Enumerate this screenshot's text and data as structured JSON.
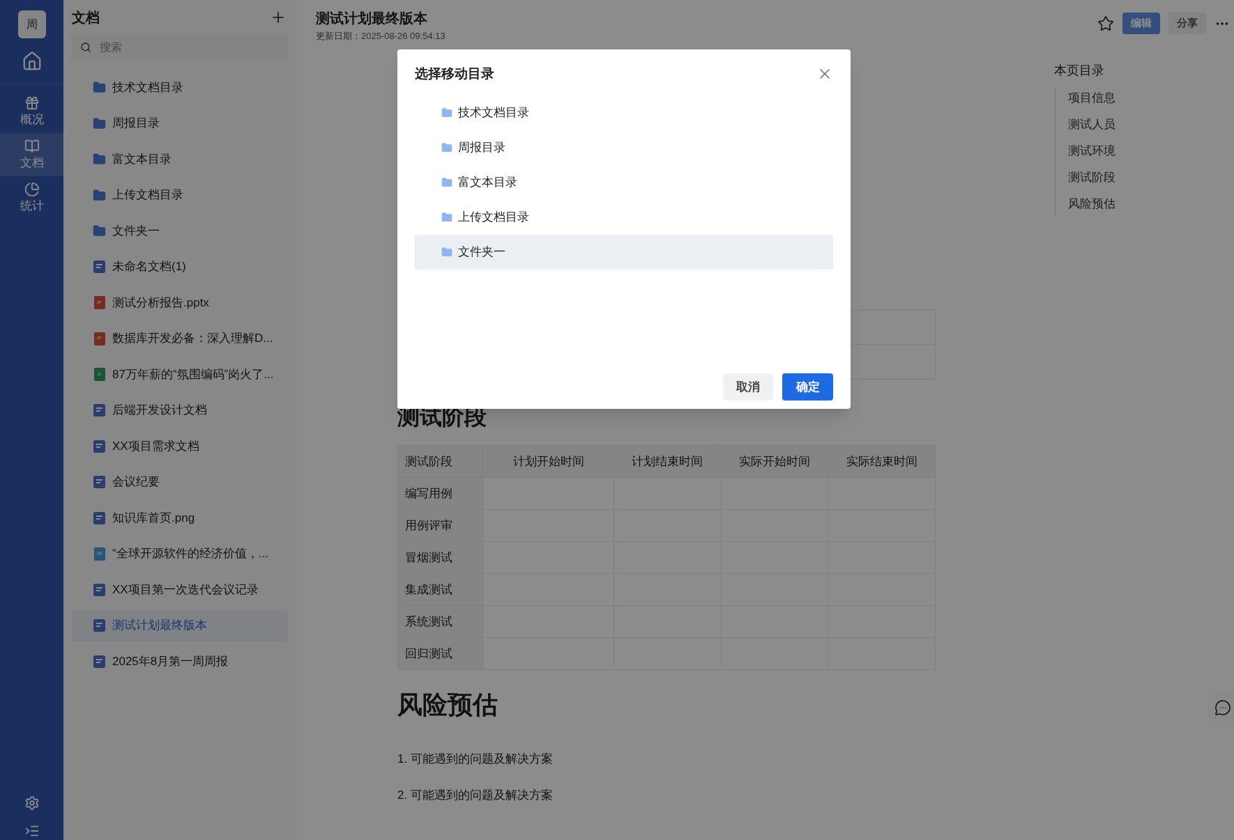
{
  "nav": {
    "avatar": "周",
    "items": [
      {
        "kind": "home",
        "selected": false
      },
      {
        "kind": "overview",
        "label": "概况",
        "selected": false
      },
      {
        "kind": "docs",
        "label": "文档",
        "selected": true
      },
      {
        "kind": "stats",
        "label": "统计",
        "selected": false
      }
    ]
  },
  "sidebar": {
    "title": "文档",
    "search": {
      "placeholder": "搜索"
    },
    "items": [
      {
        "kind": "folder",
        "label": "技术文档目录",
        "selected": false
      },
      {
        "kind": "folder",
        "label": "周报目录",
        "selected": false
      },
      {
        "kind": "folder",
        "label": "富文本目录",
        "selected": false
      },
      {
        "kind": "folder",
        "label": "上传文档目录",
        "selected": false
      },
      {
        "kind": "folder",
        "label": "文件夹一",
        "selected": false
      },
      {
        "kind": "doc",
        "label": "未命名文档(1)",
        "selected": false
      },
      {
        "kind": "ppt",
        "badge": "P",
        "label": "测试分析报告.pptx",
        "selected": false
      },
      {
        "kind": "ppt",
        "badge": "P",
        "label": "数据库开发必备：深入理解D...",
        "selected": false
      },
      {
        "kind": "xls",
        "badge": "X",
        "label": "87万年薪的“氛围编码”岗火了...",
        "selected": false
      },
      {
        "kind": "doc",
        "label": "后端开发设计文档",
        "selected": false
      },
      {
        "kind": "doc",
        "label": "XX项目需求文档",
        "selected": false
      },
      {
        "kind": "doc",
        "label": "会议纪要",
        "selected": false
      },
      {
        "kind": "doc",
        "label": "知识库首页.png",
        "selected": false
      },
      {
        "kind": "word",
        "badge": "W",
        "label": "“全球开源软件的经济价值，...",
        "selected": false
      },
      {
        "kind": "doc",
        "label": "XX项目第一次迭代会议记录",
        "selected": false
      },
      {
        "kind": "doc",
        "label": "测试计划最终版本",
        "selected": true
      },
      {
        "kind": "doc",
        "label": "2025年8月第一周周报",
        "selected": false
      }
    ]
  },
  "document": {
    "title": "测试计划最终版本",
    "updated": "更新日期：2025-08-26 09:54:13",
    "actions": {
      "edit": "编辑",
      "share": "分享"
    },
    "sections": [
      {
        "heading": "测试阶段"
      },
      {
        "heading": "风险预估"
      }
    ],
    "table": {
      "columns": [
        "测试阶段",
        "计划开始时间",
        "计划结束时间",
        "实际开始时间",
        "实际结束时间"
      ],
      "rows": [
        "编写用例",
        "用例评审",
        "冒烟测试",
        "集成测试",
        "系统测试",
        "回归测试"
      ]
    },
    "list": [
      "1. 可能遇到的问题及解决方案",
      "2. 可能遇到的问题及解决方案"
    ]
  },
  "toc": {
    "title": "本页目录",
    "items": [
      "项目信息",
      "测试人员",
      "测试环境",
      "测试阶段",
      "风险预估"
    ]
  },
  "modal": {
    "title": "选择移动目录",
    "folders": [
      {
        "label": "技术文档目录",
        "selected": false
      },
      {
        "label": "周报目录",
        "selected": false
      },
      {
        "label": "富文本目录",
        "selected": false
      },
      {
        "label": "上传文档目录",
        "selected": false
      },
      {
        "label": "文件夹一",
        "selected": true
      }
    ],
    "buttons": {
      "cancel": "取消",
      "confirm": "确定"
    }
  }
}
